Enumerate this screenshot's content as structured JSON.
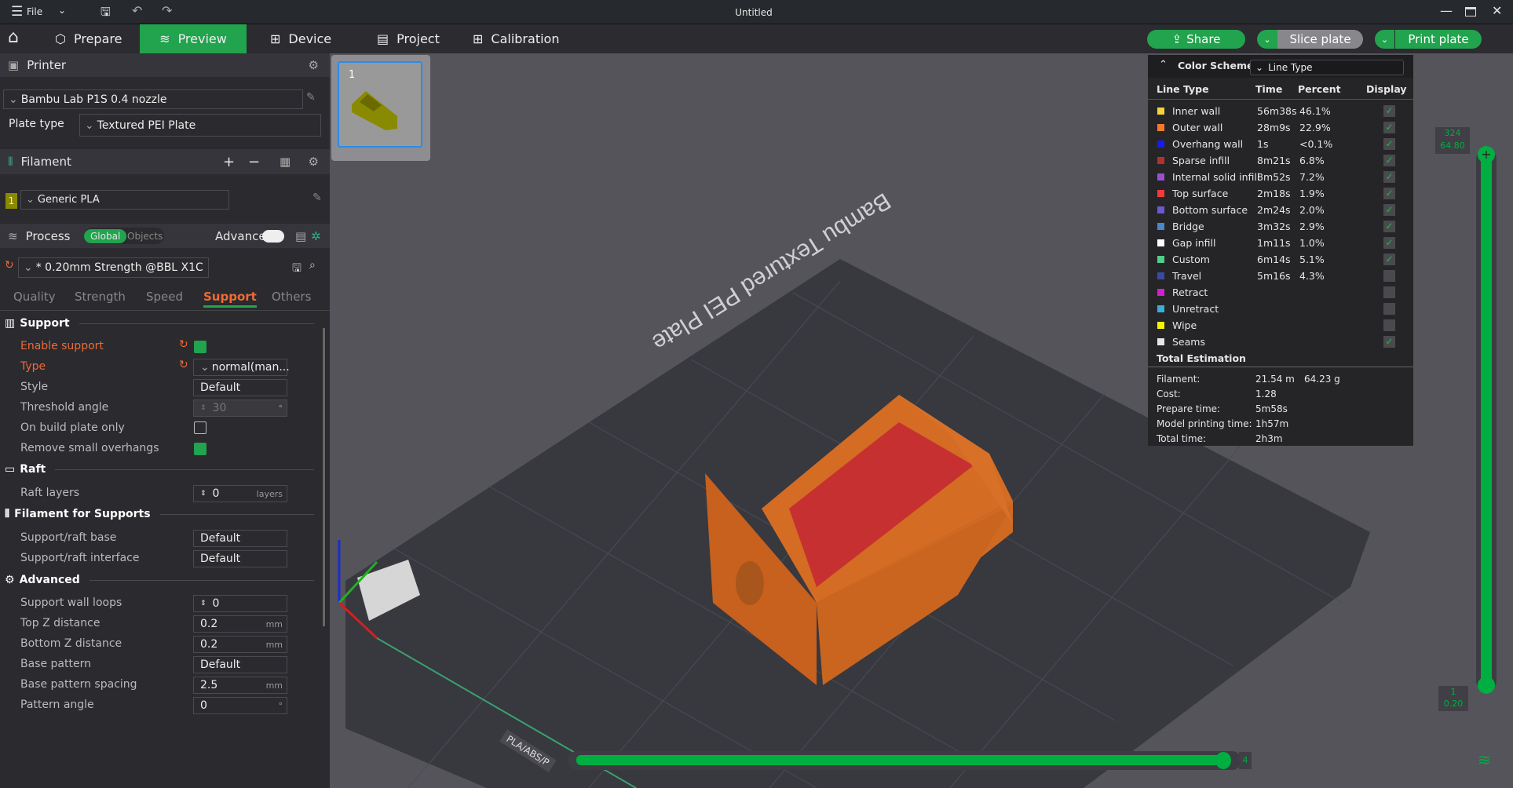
{
  "titlebar": {
    "menu": "File",
    "title": "Untitled"
  },
  "nav": {
    "tabs": [
      {
        "label": "Prepare"
      },
      {
        "label": "Preview",
        "active": true
      },
      {
        "label": "Device"
      },
      {
        "label": "Project"
      },
      {
        "label": "Calibration"
      }
    ],
    "share": "Share",
    "slice": "Slice plate",
    "print": "Print plate"
  },
  "printer": {
    "header": "Printer",
    "model": "Bambu Lab P1S 0.4 nozzle",
    "plate_label": "Plate type",
    "plate": "Textured PEI Plate"
  },
  "filament": {
    "header": "Filament",
    "slot": "1",
    "name": "Generic PLA",
    "slot_color": "#8a8a00"
  },
  "process": {
    "header": "Process",
    "global": "Global",
    "objects": "Objects",
    "advance": "Advance",
    "preset": "* 0.20mm Strength @BBL X1C",
    "tabs": [
      "Quality",
      "Strength",
      "Speed",
      "Support",
      "Others"
    ],
    "active_tab": "Support"
  },
  "settings": {
    "support": {
      "title": "Support",
      "enable": "Enable support",
      "enable_checked": true,
      "type": "Type",
      "type_val": "normal(man...",
      "style": "Style",
      "style_val": "Default",
      "threshold": "Threshold angle",
      "threshold_val": "30",
      "threshold_unit": "°",
      "build_plate": "On build plate only",
      "build_plate_checked": false,
      "remove": "Remove small overhangs",
      "remove_checked": true
    },
    "raft": {
      "title": "Raft",
      "layers": "Raft layers",
      "layers_val": "0",
      "layers_unit": "layers"
    },
    "filament": {
      "title": "Filament for Supports",
      "base": "Support/raft base",
      "base_val": "Default",
      "iface": "Support/raft interface",
      "iface_val": "Default"
    },
    "advanced": {
      "title": "Advanced",
      "wall": "Support wall loops",
      "wall_val": "0",
      "topz": "Top Z distance",
      "topz_val": "0.2",
      "botz": "Bottom Z distance",
      "botz_val": "0.2",
      "mm": "mm",
      "bp": "Base pattern",
      "bp_val": "Default",
      "bps": "Base pattern spacing",
      "bps_val": "2.5",
      "pa": "Pattern angle",
      "pa_val": "0",
      "deg": "°"
    }
  },
  "plate": {
    "number": "1",
    "bed_text": "Bambu Textured PEI Plate",
    "bed_label": "PLA/ABS/P"
  },
  "color_scheme": {
    "title": "Color Scheme",
    "mode": "Line Type",
    "headers": [
      "Line Type",
      "Time",
      "Percent",
      "Display"
    ],
    "rows": [
      {
        "name": "Inner wall",
        "time": "56m38s",
        "pct": "46.1%",
        "color": "#f5d33a",
        "on": true
      },
      {
        "name": "Outer wall",
        "time": "28m9s",
        "pct": "22.9%",
        "color": "#f07b2b",
        "on": true
      },
      {
        "name": "Overhang wall",
        "time": "1s",
        "pct": "<0.1%",
        "color": "#1a1af5",
        "on": true
      },
      {
        "name": "Sparse infill",
        "time": "8m21s",
        "pct": "6.8%",
        "color": "#b3302c",
        "on": true
      },
      {
        "name": "Internal solid infill",
        "time": "8m52s",
        "pct": "7.2%",
        "color": "#9b4fcf",
        "on": true
      },
      {
        "name": "Top surface",
        "time": "2m18s",
        "pct": "1.9%",
        "color": "#ee3b3b",
        "on": true
      },
      {
        "name": "Bottom surface",
        "time": "2m24s",
        "pct": "2.0%",
        "color": "#6a5ad0",
        "on": true
      },
      {
        "name": "Bridge",
        "time": "3m32s",
        "pct": "2.9%",
        "color": "#4a86c8",
        "on": true
      },
      {
        "name": "Gap infill",
        "time": "1m11s",
        "pct": "1.0%",
        "color": "#ffffff",
        "on": true
      },
      {
        "name": "Custom",
        "time": "6m14s",
        "pct": "5.1%",
        "color": "#4fcf8a",
        "on": true
      },
      {
        "name": "Travel",
        "time": "5m16s",
        "pct": "4.3%",
        "color": "#3a4aa0",
        "on": false
      },
      {
        "name": "Retract",
        "time": "",
        "pct": "",
        "color": "#d21fd2",
        "on": false
      },
      {
        "name": "Unretract",
        "time": "",
        "pct": "",
        "color": "#3aaed8",
        "on": false
      },
      {
        "name": "Wipe",
        "time": "",
        "pct": "",
        "color": "#f5f500",
        "on": false
      },
      {
        "name": "Seams",
        "time": "",
        "pct": "",
        "color": "#e6e6e6",
        "on": true
      }
    ],
    "total_title": "Total Estimation",
    "totals": [
      {
        "k": "Filament:",
        "v": "21.54 m",
        "v2": "64.23 g"
      },
      {
        "k": "Cost:",
        "v": "1.28"
      },
      {
        "k": "Prepare time:",
        "v": "5m58s"
      },
      {
        "k": "Model printing time:",
        "v": "1h57m"
      },
      {
        "k": "Total time:",
        "v": "2h3m"
      }
    ]
  },
  "layer_slider": {
    "top_layer": "324",
    "top_height": "64.80",
    "bottom_layer": "1",
    "bottom_height": "0.20"
  },
  "move_slider": {
    "value": "4"
  },
  "colors": {
    "accent": "#22a34e",
    "warn": "#f06a35"
  }
}
